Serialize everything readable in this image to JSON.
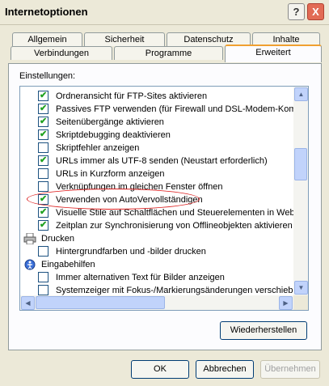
{
  "window": {
    "title": "Internetoptionen",
    "help_glyph": "?",
    "close_glyph": "X"
  },
  "tabs": {
    "row1": [
      "Allgemein",
      "Sicherheit",
      "Datenschutz",
      "Inhalte"
    ],
    "row2": [
      "Verbindungen",
      "Programme",
      "Erweitert"
    ],
    "active": "Erweitert"
  },
  "settings": {
    "label": "Einstellungen:",
    "items": [
      {
        "text": "Ordneransicht für FTP-Sites aktivieren",
        "checked": true
      },
      {
        "text": "Passives FTP verwenden (für Firewall und DSL-Modem-Kompa",
        "checked": true
      },
      {
        "text": "Seitenübergänge aktivieren",
        "checked": true
      },
      {
        "text": "Skriptdebugging deaktivieren",
        "checked": true
      },
      {
        "text": "Skriptfehler anzeigen",
        "checked": false
      },
      {
        "text": "URLs immer als UTF-8 senden (Neustart erforderlich)",
        "checked": true
      },
      {
        "text": "URLs in Kurzform anzeigen",
        "checked": false
      },
      {
        "text": "Verknüpfungen im gleichen Fenster öffnen",
        "checked": false
      },
      {
        "text": "Verwenden von AutoVervollständigen",
        "checked": true
      },
      {
        "text": "Visuelle Stile auf Schaltflächen und Steuerelementen in Webs",
        "checked": true
      },
      {
        "text": "Zeitplan zur Synchronisierung von Offlineobjekten aktivieren",
        "checked": true
      }
    ],
    "group_drucken": {
      "label": "Drucken",
      "icon": "printer-icon"
    },
    "drucken_items": [
      {
        "text": "Hintergrundfarben und -bilder drucken",
        "checked": false
      }
    ],
    "group_eingabe": {
      "label": "Eingabehilfen",
      "icon": "accessibility-icon"
    },
    "eingabe_items": [
      {
        "text": "Immer alternativen Text für Bilder anzeigen",
        "checked": false
      },
      {
        "text": "Systemzeiger mit Fokus-/Markierungsänderungen verschieben",
        "checked": false
      }
    ]
  },
  "buttons": {
    "restore": "Wiederherstellen",
    "ok": "OK",
    "cancel": "Abbrechen",
    "apply": "Übernehmen"
  },
  "colors": {
    "check": "#21a121",
    "annotation": "#dd2222",
    "active_tab_accent": "#f0a030"
  }
}
